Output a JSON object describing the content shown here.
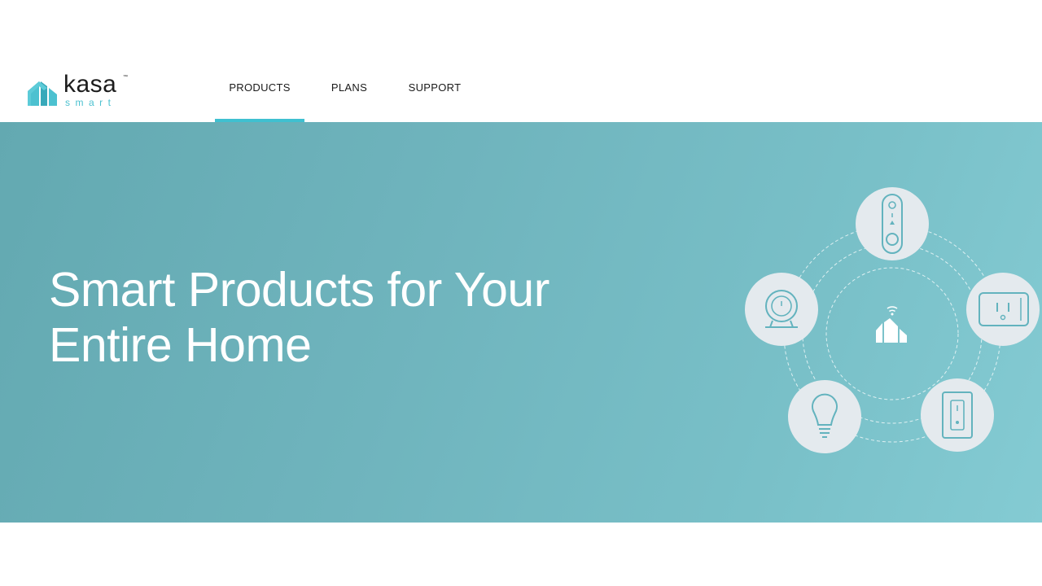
{
  "brand": {
    "name": "kasa",
    "tagline": "smart",
    "trademark": "™",
    "accent": "#3fc0d0"
  },
  "nav": {
    "items": [
      {
        "label": "PRODUCTS",
        "active": true
      },
      {
        "label": "PLANS",
        "active": false
      },
      {
        "label": "SUPPORT",
        "active": false
      }
    ]
  },
  "hero": {
    "title_line1": "Smart Products for Your",
    "title_line2": "Entire Home",
    "background": "#6fb4bd",
    "devices": [
      "doorbell-icon",
      "smart-plug-icon",
      "light-switch-icon",
      "smart-bulb-icon",
      "camera-icon",
      "kasa-hub-icon"
    ]
  }
}
